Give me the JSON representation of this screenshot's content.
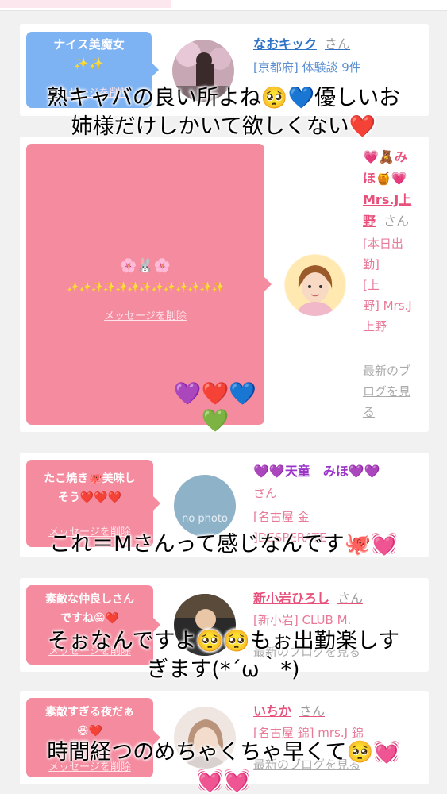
{
  "cards": [
    {
      "bubble_lines": [
        "ナイス美魔女",
        "✨✨"
      ],
      "name": "なおキック",
      "suffix": "さん",
      "meta": [
        "[京都府] 体験談 9件"
      ],
      "delete_label": "メッセージを削除"
    },
    {
      "bubble_lines": [
        "🌸🐰🌸",
        "✨✨✨✨✨✨✨✨✨✨✨✨✨"
      ],
      "delete_label": "メッセージを削除",
      "hearts": "💜❤️💙💚",
      "name_lines": [
        "💗🧸み",
        "ほ🍯💗",
        "Mrs.J上",
        "野"
      ],
      "suffix": "さん",
      "meta": [
        "[本日出",
        "勤]",
        "[上",
        "野] Mrs.J",
        "上野"
      ],
      "link": [
        "最新のブ",
        "ログを見",
        "る"
      ]
    },
    {
      "bubble_lines": [
        "たこ焼き🐙美味し",
        "そう❤️❤️❤️"
      ],
      "delete_label": "メッセージを削除",
      "avatar_text": "no photo",
      "name": "💜💜天童　みほ💜💜",
      "suffix": "さん",
      "meta": [
        "[名古屋 金",
        "]DESPERATE"
      ]
    },
    {
      "bubble_lines": [
        "素敵な仲良しさん",
        "ですね😁❤️"
      ],
      "delete_label": "メッセージを削除",
      "name": "新小岩ひろし",
      "suffix": "さん",
      "meta": [
        "[新小岩] CLUB M."
      ],
      "link": "最新のブログを見る"
    },
    {
      "bubble_lines": [
        "素敵すぎる夜だぁ",
        "😆❤️"
      ],
      "delete_label": "メッセージを削除",
      "name": "いちか",
      "suffix": "さん",
      "meta": [
        "[名古屋 錦] mrs.J 錦"
      ],
      "link": "最新のブログを見る"
    }
  ],
  "captions": [
    [
      "熟キャバの良い所よね🥺💙優しいお",
      "姉様だけしかいて欲しくない❤️"
    ],
    [
      "これ＝Mさんって感じなんです🐙💓"
    ],
    [
      "そぉなんですよ🥺🥺もぉ出勤楽しす",
      "ぎます(*´ω｀*)"
    ],
    [
      "時間経つのめちゃくちゃ早くて🥺💓",
      "💓💓"
    ]
  ],
  "colors": {
    "blue_link": "#2f73c8",
    "pink_name": "#e8517b",
    "purple_name": "#9b35c9",
    "bubble_blue": "#7db2f3",
    "bubble_pink": "#f48b9f"
  }
}
